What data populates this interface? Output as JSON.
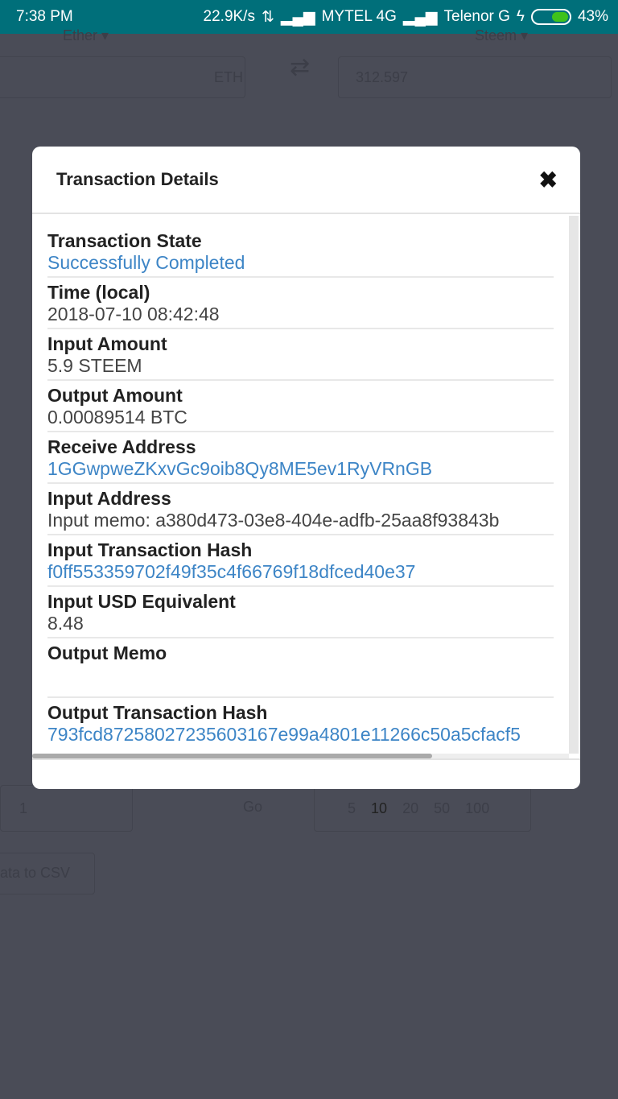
{
  "status_bar": {
    "time": "7:38 PM",
    "speed": "22.9K/s",
    "carrier1": "MYTEL 4G",
    "carrier2": "Telenor G",
    "battery": "43%",
    "battery_level": 0.43
  },
  "background": {
    "from_currency": "Ether",
    "to_currency": "Steem",
    "from_unit": "ETH",
    "to_amount": "312.597",
    "pagination_page": "1",
    "go_label": "Go",
    "page_sizes": [
      "5",
      "10",
      "20",
      "50",
      "100"
    ],
    "export_label": "ata to CSV"
  },
  "modal": {
    "title": "Transaction Details",
    "rows": [
      {
        "label": "Transaction State",
        "value": "Successfully Completed"
      },
      {
        "label": "Time (local)",
        "value": "2018-07-10 08:42:48"
      },
      {
        "label": "Input Amount",
        "value": "5.9 STEEM"
      },
      {
        "label": "Output Amount",
        "value": "0.00089514 BTC"
      },
      {
        "label": "Receive Address",
        "value": "1GGwpweZKxvGc9oib8Qy8ME5ev1RyVRnGB"
      },
      {
        "label": "Input Address",
        "value": "Input memo: a380d473-03e8-404e-adfb-25aa8f93843b"
      },
      {
        "label": "Input Transaction Hash",
        "value": "f0ff553359702f49f35c4f66769f18dfced40e37"
      },
      {
        "label": "Input USD Equivalent",
        "value": "8.48"
      },
      {
        "label": "Output Memo",
        "value": ""
      },
      {
        "label": "Output Transaction Hash",
        "value": "793fcd87258027235603167e99a4801e11266c50a5cfacf5"
      }
    ]
  },
  "colors": {
    "link": "#3d85c6",
    "status_bar": "#006f7a",
    "overlay": "#4a4c57"
  }
}
